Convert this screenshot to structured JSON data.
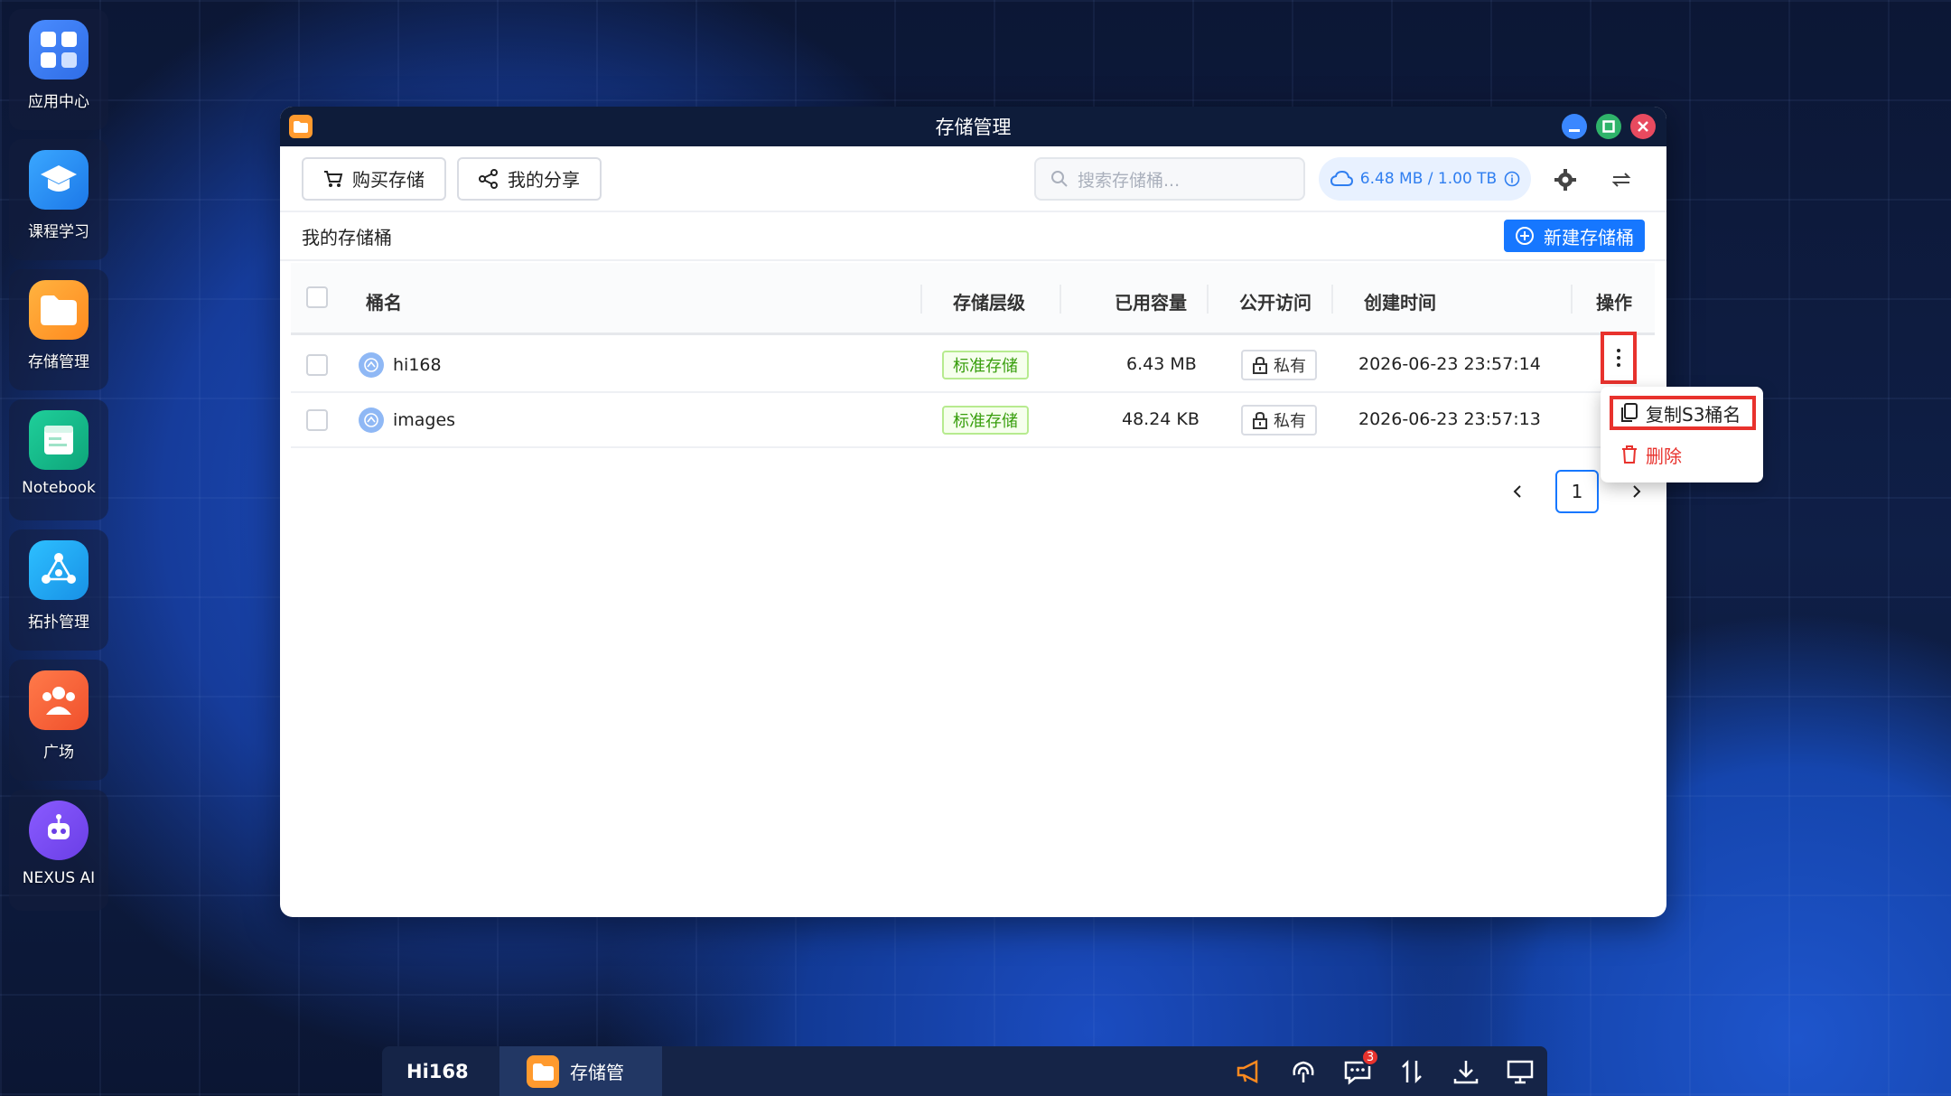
{
  "dock": {
    "items": [
      {
        "label": "应用中心",
        "icon": "app-center-icon"
      },
      {
        "label": "课程学习",
        "icon": "graduation-cap-icon"
      },
      {
        "label": "存储管理",
        "icon": "folder-icon"
      },
      {
        "label": "Notebook",
        "icon": "notebook-icon"
      },
      {
        "label": "拓扑管理",
        "icon": "topology-icon"
      },
      {
        "label": "广场",
        "icon": "community-icon"
      },
      {
        "label": "NEXUS AI",
        "icon": "robot-icon"
      }
    ]
  },
  "window": {
    "title": "存储管理",
    "toolbar": {
      "buy_label": "购买存储",
      "share_label": "我的分享",
      "search_placeholder": "搜索存储桶...",
      "quota": "6.48 MB / 1.00 TB"
    },
    "subbar": {
      "heading": "我的存储桶",
      "new_button": "新建存储桶"
    },
    "table": {
      "columns": [
        "桶名",
        "存储层级",
        "已用容量",
        "公开访问",
        "创建时间",
        "操作"
      ],
      "rows": [
        {
          "name": "hi168",
          "tier": "标准存储",
          "used": "6.43 MB",
          "access": "私有",
          "created": "2026-06-23 23:57:14"
        },
        {
          "name": "images",
          "tier": "标准存储",
          "used": "48.24 KB",
          "access": "私有",
          "created": "2026-06-23 23:57:13"
        }
      ]
    },
    "pagination": {
      "current": "1"
    },
    "dropdown": {
      "copy_label": "复制S3桶名",
      "delete_label": "删除"
    }
  },
  "taskbar": {
    "brand": "Hi168",
    "active_app": "存储管",
    "badge_count": "3"
  },
  "colors": {
    "accent": "#1677ff",
    "highlight_red": "#e8322d",
    "tag_green": "#389e0d"
  }
}
